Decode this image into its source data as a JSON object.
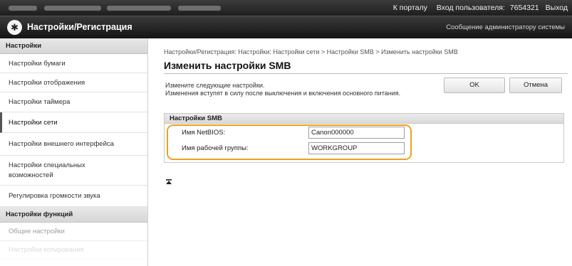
{
  "topbar": {
    "portal_link": "К порталу",
    "login_label": "Вход пользователя:",
    "user_id": "7654321",
    "logout_link": "Выход"
  },
  "header": {
    "title": "Настройки/Регистрация",
    "admin_message_link": "Сообщение администратору системы"
  },
  "sidebar": {
    "section_settings": "Настройки",
    "items": [
      {
        "label": "Настройки бумаги"
      },
      {
        "label": "Настройки отображения"
      },
      {
        "label": "Настройки таймера"
      },
      {
        "label": "Настройки сети"
      },
      {
        "label": "Настройки внешнего интерфейса"
      },
      {
        "label": "Настройки специальных возможностей"
      },
      {
        "label": "Регулировка громкости звука"
      }
    ],
    "section_functions": "Настройки функций",
    "function_items": [
      {
        "label": "Общие настройки"
      },
      {
        "label": "Настройки копирования"
      }
    ]
  },
  "main": {
    "breadcrumb": "Настройки/Регистрация: Настройки: Настройки сети > Настройки SMB > Изменить настройки SMB",
    "title": "Изменить настройки SMB",
    "description": "Измените следующие настройки.\nИзменения вступят в силу после выключения и включения основного питания.",
    "ok_label": "OK",
    "cancel_label": "Отмена",
    "panel_title": "Настройки SMB",
    "fields": {
      "netbios_label": "Имя NetBIOS:",
      "netbios_value": "Canon000000",
      "workgroup_label": "Имя рабочей группы:",
      "workgroup_value": "WORKGROUP"
    }
  },
  "colors": {
    "highlight": "#f0a020",
    "header_bg": "#1e1e1e"
  },
  "icons": {
    "logo": "canon-emblem-icon",
    "back_to_top": "back-to-top-icon"
  }
}
